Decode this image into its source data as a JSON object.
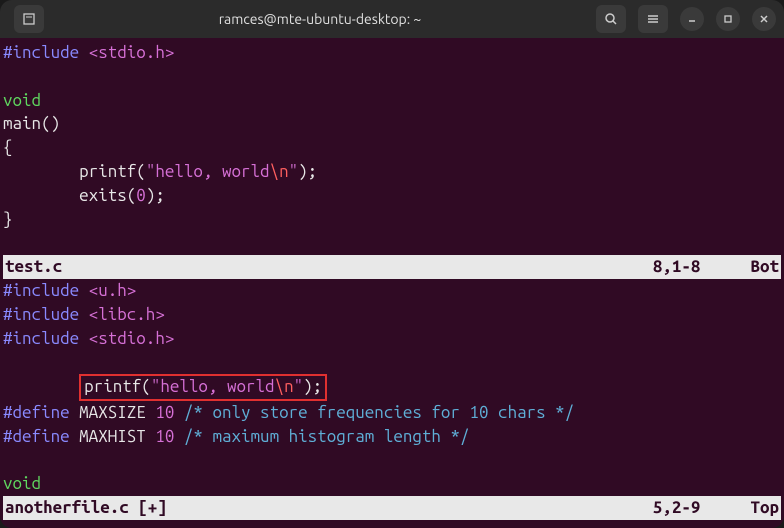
{
  "window": {
    "title": "ramces@mte-ubuntu-desktop: ~"
  },
  "pane1": {
    "line1_include": "#include",
    "line1_header": " <stdio.h>",
    "line3_void": "void",
    "line4_main": "main()",
    "line5_brace": "{",
    "line6_indent": "        ",
    "line6_printf": "printf(",
    "line6_str1": "\"hello, world",
    "line6_esc": "\\n",
    "line6_str2": "\"",
    "line6_close": ");",
    "line7_indent": "        ",
    "line7_exits": "exits(",
    "line7_zero": "0",
    "line7_close": ");",
    "line8_brace": "}",
    "status_file": "test.c",
    "status_pos": "8,1-8",
    "status_loc": "Bot"
  },
  "pane2": {
    "line1_include": "#include",
    "line1_header": " <u.h>",
    "line2_include": "#include",
    "line2_header": " <libc.h>",
    "line3_include": "#include",
    "line3_header": " <stdio.h>",
    "line5_indent": "        ",
    "line5_printf": "printf(",
    "line5_str1": "\"hello, world",
    "line5_esc": "\\n",
    "line5_str2": "\"",
    "line5_close": ");",
    "line6_define": "#define",
    "line6_macro": " MAXSIZE ",
    "line6_val": "10",
    "line6_comment": " /* only store frequencies for 10 chars */",
    "line7_define": "#define",
    "line7_macro": " MAXHIST ",
    "line7_val": "10",
    "line7_comment": " /* maximum histogram length */",
    "line9_void": "void",
    "status_file": "anotherfile.c [+]",
    "status_pos": "5,2-9",
    "status_loc": "Top"
  }
}
